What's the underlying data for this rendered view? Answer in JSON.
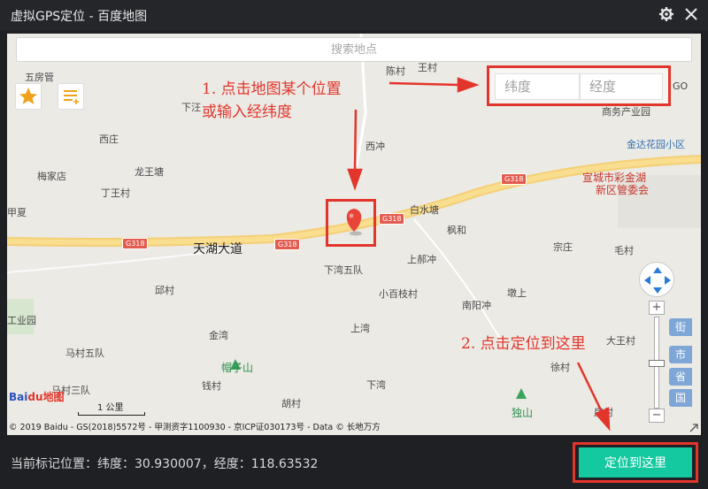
{
  "window": {
    "title": "虚拟GPS定位 - 百度地图",
    "settings_icon": "gear-icon",
    "close_icon": "close-icon"
  },
  "search": {
    "placeholder": "搜索地点"
  },
  "coords_input": {
    "lat_placeholder": "纬度",
    "lng_placeholder": "经度"
  },
  "annotations": {
    "step1_line1": "1. 点击地图某个位置",
    "step1_line2": "或输入经纬度",
    "step2": "2. 点击定位到这里"
  },
  "map": {
    "places": [
      {
        "text": "五房管"
      },
      {
        "text": "下汪"
      },
      {
        "text": "西庄"
      },
      {
        "text": "梅家店"
      },
      {
        "text": "龙王塘"
      },
      {
        "text": "丁王村"
      },
      {
        "text": "甲夏"
      },
      {
        "text": "陈村"
      },
      {
        "text": "王村"
      },
      {
        "text": "西冲"
      },
      {
        "text": "白水塘"
      },
      {
        "text": "枫和"
      },
      {
        "text": "宗庄"
      },
      {
        "text": "毛村"
      },
      {
        "text": "上郝冲"
      },
      {
        "text": "下湾五队"
      },
      {
        "text": "小百枝村"
      },
      {
        "text": "墩上"
      },
      {
        "text": "邱村"
      },
      {
        "text": "上湾"
      },
      {
        "text": "南阳冲"
      },
      {
        "text": "大王村"
      },
      {
        "text": "金湾"
      },
      {
        "text": "马村五队"
      },
      {
        "text": "徐村"
      },
      {
        "text": "钱村"
      },
      {
        "text": "马村三队"
      },
      {
        "text": "胡村"
      },
      {
        "text": "下湾"
      },
      {
        "text": "房村"
      },
      {
        "text": "工业园"
      },
      {
        "text": "GO"
      }
    ],
    "road_name": "天湖大道",
    "road_shield": "G318",
    "poi_business": "商务产业园",
    "poi_garden": "金达花园小区",
    "poi_district": "宣城市彩金湖新区管委会",
    "poi_district_line1": "宣城市彩金湖",
    "poi_district_line2": "新区管委会",
    "poi_mountain1": "帽子山",
    "poi_mountain2": "独山",
    "level_tags": [
      "街",
      "市",
      "省",
      "国"
    ],
    "zoom_in": "+",
    "zoom_out": "−",
    "logo_baidu": "Bai",
    "logo_du": "du",
    "logo_map": "地图",
    "scale_label": "1 公里",
    "copyright": "© 2019 Baidu - GS(2018)5572号 - 甲测资字1100930 - 京ICP证030173号 - Data © 长地万方"
  },
  "footer": {
    "status": "当前标记位置：纬度：30.930007，经度：118.63532",
    "locate_button": "定位到这里"
  },
  "colors": {
    "accent": "#14c9a0",
    "annotation_red": "#e2352b",
    "titlebar": "#24262a"
  }
}
